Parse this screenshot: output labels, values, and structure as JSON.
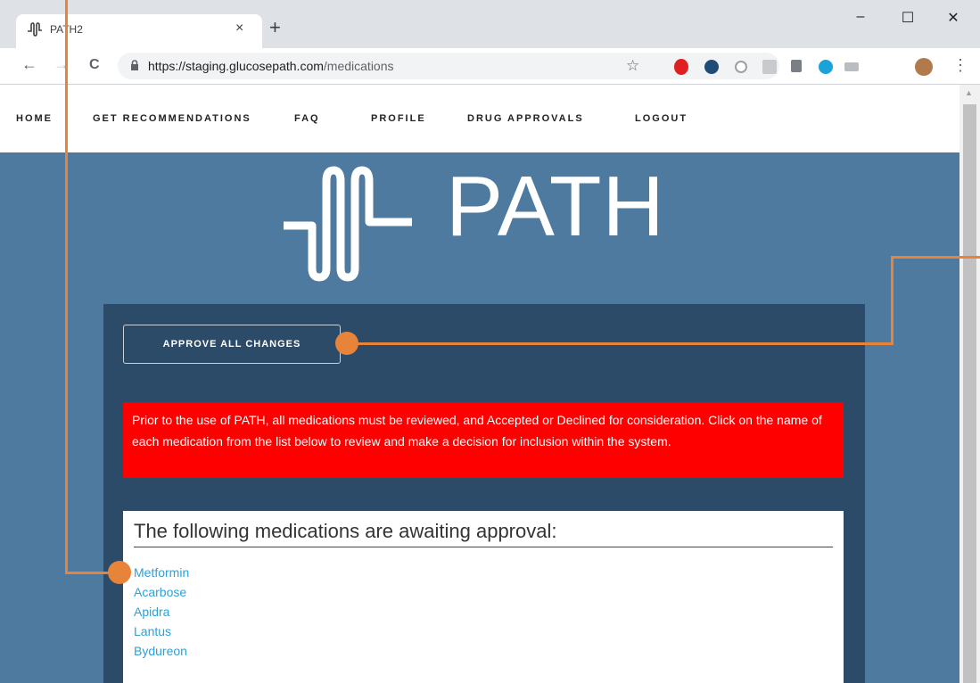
{
  "browser": {
    "tab_title": "PATH2",
    "tab_close": "×",
    "new_tab": "+",
    "minimize": "–",
    "maximize": "☐",
    "close": "✕",
    "back": "←",
    "forward": "→",
    "reload": "C",
    "url_host": "https://staging.glucosepath.com",
    "url_path": "/medications",
    "bookmark": "☆",
    "menu": "⋮"
  },
  "nav": {
    "items": [
      "HOME",
      "GET RECOMMENDATIONS",
      "FAQ",
      "PROFILE",
      "DRUG APPROVALS",
      "LOGOUT"
    ]
  },
  "logo": {
    "text": "PATH"
  },
  "approve_button": {
    "label": "APPROVE ALL CHANGES"
  },
  "alert": {
    "text": "Prior to the use of PATH, all medications must be reviewed, and Accepted or Declined for consideration. Click on the name of each medication from the list below to review and make a decision for inclusion within the system."
  },
  "medications": {
    "heading": "The following medications are awaiting approval:",
    "items": [
      "Metformin",
      "Acarbose",
      "Apidra",
      "Lantus",
      "Bydureon"
    ]
  },
  "colors": {
    "page_bg": "#4d7a9e",
    "panel_bg": "#2b4b68",
    "alert_bg": "#ff0000",
    "link": "#2fa0d6",
    "annotation": "#e8833a"
  }
}
